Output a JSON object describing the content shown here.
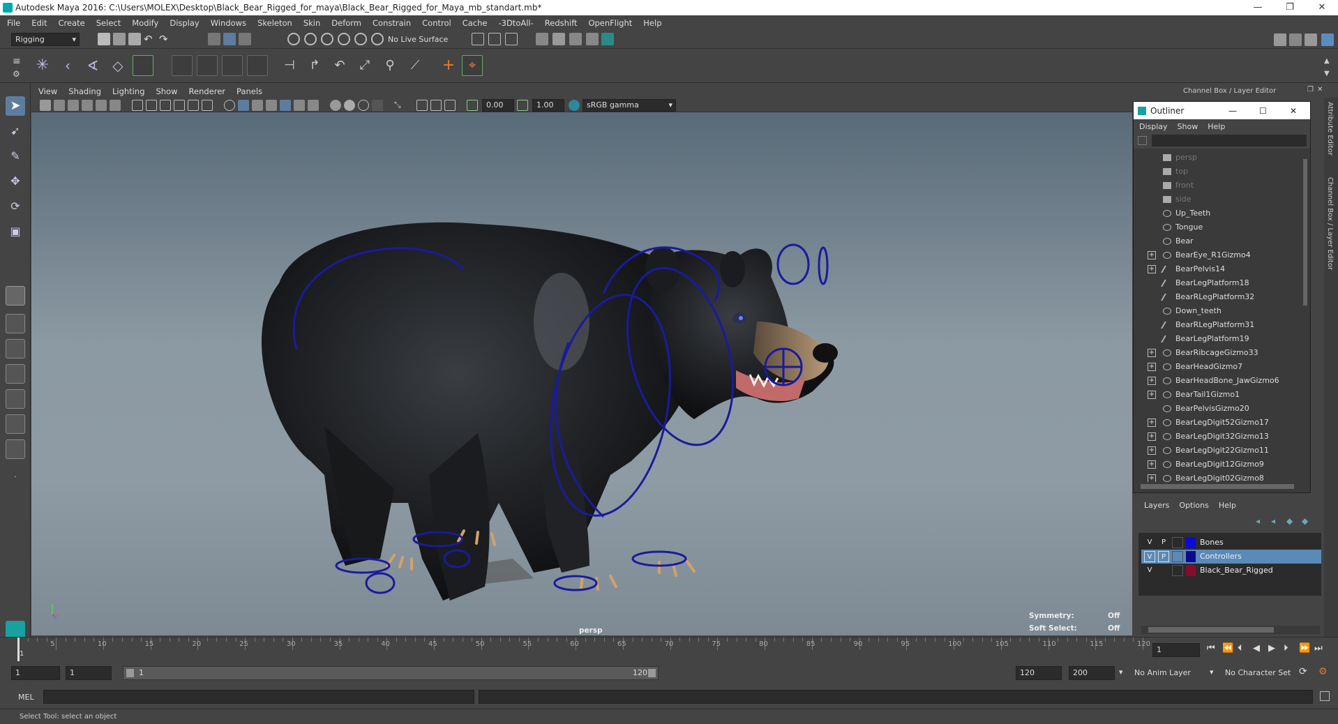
{
  "window": {
    "title": "Autodesk Maya 2016: C:\\Users\\MOLEX\\Desktop\\Black_Bear_Rigged_for_maya\\Black_Bear_Rigged_for_Maya_mb_standart.mb*",
    "minimize": "—",
    "restore": "❐",
    "close": "✕"
  },
  "menu": [
    "File",
    "Edit",
    "Create",
    "Select",
    "Modify",
    "Display",
    "Windows",
    "Skeleton",
    "Skin",
    "Deform",
    "Constrain",
    "Control",
    "Cache",
    "-3DtoAll-",
    "Redshift",
    "OpenFlight",
    "Help"
  ],
  "statusline": {
    "mode": "Rigging",
    "live_surface": "No Live Surface"
  },
  "panel_menu": [
    "View",
    "Shading",
    "Lighting",
    "Show",
    "Renderer",
    "Panels"
  ],
  "panel_toolbar": {
    "exposure": "0.00",
    "gamma": "1.00",
    "color_space": "sRGB gamma"
  },
  "viewport": {
    "camera": "persp",
    "symmetry_label": "Symmetry:",
    "symmetry_value": "Off",
    "soft_select_label": "Soft Select:",
    "soft_select_value": "Off",
    "accent": "#1a1a9e"
  },
  "channel_box_title": "Channel Box / Layer Editor",
  "side_tabs": {
    "attribute": "Attribute Editor",
    "channel": "Channel Box / Layer Editor"
  },
  "outliner": {
    "title": "Outliner",
    "menu": [
      "Display",
      "Show",
      "Help"
    ],
    "items": [
      {
        "name": "persp",
        "type": "camera",
        "expand": false,
        "dim": true
      },
      {
        "name": "top",
        "type": "camera",
        "expand": false,
        "dim": true
      },
      {
        "name": "front",
        "type": "camera",
        "expand": false,
        "dim": true
      },
      {
        "name": "side",
        "type": "camera",
        "expand": false,
        "dim": true
      },
      {
        "name": "Up_Teeth",
        "type": "mesh",
        "expand": false
      },
      {
        "name": "Tongue",
        "type": "mesh",
        "expand": false
      },
      {
        "name": "Bear",
        "type": "mesh",
        "expand": false
      },
      {
        "name": "BearEye_R1Gizmo4",
        "type": "mesh",
        "expand": true
      },
      {
        "name": "BearPelvis14",
        "type": "joint",
        "expand": true
      },
      {
        "name": "BearLegPlatform18",
        "type": "joint",
        "expand": false
      },
      {
        "name": "BearRLegPlatform32",
        "type": "joint",
        "expand": false
      },
      {
        "name": "Down_teeth",
        "type": "mesh",
        "expand": false
      },
      {
        "name": "BearRLegPlatform31",
        "type": "joint",
        "expand": false
      },
      {
        "name": "BearLegPlatform19",
        "type": "joint",
        "expand": false
      },
      {
        "name": "BearRibcageGizmo33",
        "type": "mesh",
        "expand": true
      },
      {
        "name": "BearHeadGizmo7",
        "type": "mesh",
        "expand": true
      },
      {
        "name": "BearHeadBone_JawGizmo6",
        "type": "mesh",
        "expand": true
      },
      {
        "name": "BearTail1Gizmo1",
        "type": "mesh",
        "expand": true
      },
      {
        "name": "BearPelvisGizmo20",
        "type": "mesh",
        "expand": false
      },
      {
        "name": "BearLegDigit52Gizmo17",
        "type": "mesh",
        "expand": true
      },
      {
        "name": "BearLegDigit32Gizmo13",
        "type": "mesh",
        "expand": true
      },
      {
        "name": "BearLegDigit22Gizmo11",
        "type": "mesh",
        "expand": true
      },
      {
        "name": "BearLegDigit12Gizmo9",
        "type": "mesh",
        "expand": true
      },
      {
        "name": "BearLegDigit02Gizmo8",
        "type": "mesh",
        "expand": true
      }
    ]
  },
  "layer_editor": {
    "menu": [
      "Layers",
      "Options",
      "Help"
    ],
    "layers": [
      {
        "v": "V",
        "p": "P",
        "name": "Bones",
        "color": "#0a0adc",
        "selected": false
      },
      {
        "v": "V",
        "p": "P",
        "name": "Controllers",
        "color": "#0a0a8a",
        "selected": true
      },
      {
        "v": "V",
        "p": "",
        "name": "Black_Bear_Rigged",
        "color": "#8a0a2a",
        "selected": false
      }
    ]
  },
  "timeline": {
    "ticks": [
      "5",
      "10",
      "15",
      "20",
      "25",
      "30",
      "35",
      "40",
      "45",
      "50",
      "55",
      "60",
      "65",
      "70",
      "75",
      "80",
      "85",
      "90",
      "95",
      "100",
      "105",
      "110",
      "115",
      "120"
    ],
    "start": "1",
    "current_frame": "1"
  },
  "range": {
    "start": "1",
    "inner_start": "1",
    "slider_start": "1",
    "slider_end": "120",
    "end": "120",
    "max": "200",
    "anim_layer": "No Anim Layer",
    "character_set": "No Character Set"
  },
  "command": {
    "label": "MEL"
  },
  "help_text": "Select Tool: select an object"
}
